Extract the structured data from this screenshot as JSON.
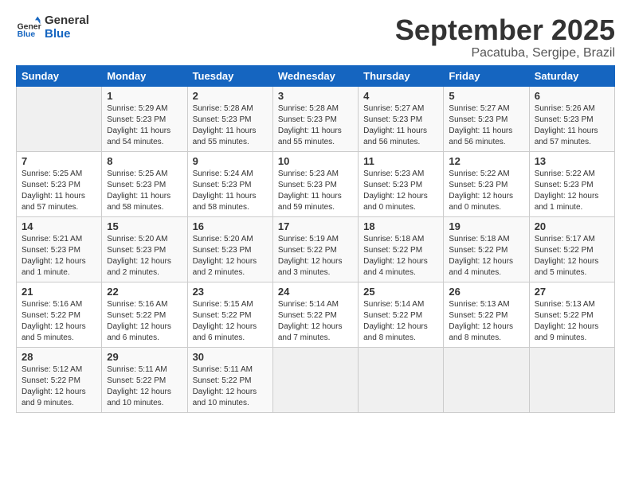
{
  "header": {
    "logo_line1": "General",
    "logo_line2": "Blue",
    "month": "September 2025",
    "location": "Pacatuba, Sergipe, Brazil"
  },
  "weekdays": [
    "Sunday",
    "Monday",
    "Tuesday",
    "Wednesday",
    "Thursday",
    "Friday",
    "Saturday"
  ],
  "weeks": [
    [
      {
        "day": "",
        "info": ""
      },
      {
        "day": "1",
        "info": "Sunrise: 5:29 AM\nSunset: 5:23 PM\nDaylight: 11 hours\nand 54 minutes."
      },
      {
        "day": "2",
        "info": "Sunrise: 5:28 AM\nSunset: 5:23 PM\nDaylight: 11 hours\nand 55 minutes."
      },
      {
        "day": "3",
        "info": "Sunrise: 5:28 AM\nSunset: 5:23 PM\nDaylight: 11 hours\nand 55 minutes."
      },
      {
        "day": "4",
        "info": "Sunrise: 5:27 AM\nSunset: 5:23 PM\nDaylight: 11 hours\nand 56 minutes."
      },
      {
        "day": "5",
        "info": "Sunrise: 5:27 AM\nSunset: 5:23 PM\nDaylight: 11 hours\nand 56 minutes."
      },
      {
        "day": "6",
        "info": "Sunrise: 5:26 AM\nSunset: 5:23 PM\nDaylight: 11 hours\nand 57 minutes."
      }
    ],
    [
      {
        "day": "7",
        "info": "Sunrise: 5:25 AM\nSunset: 5:23 PM\nDaylight: 11 hours\nand 57 minutes."
      },
      {
        "day": "8",
        "info": "Sunrise: 5:25 AM\nSunset: 5:23 PM\nDaylight: 11 hours\nand 58 minutes."
      },
      {
        "day": "9",
        "info": "Sunrise: 5:24 AM\nSunset: 5:23 PM\nDaylight: 11 hours\nand 58 minutes."
      },
      {
        "day": "10",
        "info": "Sunrise: 5:23 AM\nSunset: 5:23 PM\nDaylight: 11 hours\nand 59 minutes."
      },
      {
        "day": "11",
        "info": "Sunrise: 5:23 AM\nSunset: 5:23 PM\nDaylight: 12 hours\nand 0 minutes."
      },
      {
        "day": "12",
        "info": "Sunrise: 5:22 AM\nSunset: 5:23 PM\nDaylight: 12 hours\nand 0 minutes."
      },
      {
        "day": "13",
        "info": "Sunrise: 5:22 AM\nSunset: 5:23 PM\nDaylight: 12 hours\nand 1 minute."
      }
    ],
    [
      {
        "day": "14",
        "info": "Sunrise: 5:21 AM\nSunset: 5:23 PM\nDaylight: 12 hours\nand 1 minute."
      },
      {
        "day": "15",
        "info": "Sunrise: 5:20 AM\nSunset: 5:23 PM\nDaylight: 12 hours\nand 2 minutes."
      },
      {
        "day": "16",
        "info": "Sunrise: 5:20 AM\nSunset: 5:23 PM\nDaylight: 12 hours\nand 2 minutes."
      },
      {
        "day": "17",
        "info": "Sunrise: 5:19 AM\nSunset: 5:22 PM\nDaylight: 12 hours\nand 3 minutes."
      },
      {
        "day": "18",
        "info": "Sunrise: 5:18 AM\nSunset: 5:22 PM\nDaylight: 12 hours\nand 4 minutes."
      },
      {
        "day": "19",
        "info": "Sunrise: 5:18 AM\nSunset: 5:22 PM\nDaylight: 12 hours\nand 4 minutes."
      },
      {
        "day": "20",
        "info": "Sunrise: 5:17 AM\nSunset: 5:22 PM\nDaylight: 12 hours\nand 5 minutes."
      }
    ],
    [
      {
        "day": "21",
        "info": "Sunrise: 5:16 AM\nSunset: 5:22 PM\nDaylight: 12 hours\nand 5 minutes."
      },
      {
        "day": "22",
        "info": "Sunrise: 5:16 AM\nSunset: 5:22 PM\nDaylight: 12 hours\nand 6 minutes."
      },
      {
        "day": "23",
        "info": "Sunrise: 5:15 AM\nSunset: 5:22 PM\nDaylight: 12 hours\nand 6 minutes."
      },
      {
        "day": "24",
        "info": "Sunrise: 5:14 AM\nSunset: 5:22 PM\nDaylight: 12 hours\nand 7 minutes."
      },
      {
        "day": "25",
        "info": "Sunrise: 5:14 AM\nSunset: 5:22 PM\nDaylight: 12 hours\nand 8 minutes."
      },
      {
        "day": "26",
        "info": "Sunrise: 5:13 AM\nSunset: 5:22 PM\nDaylight: 12 hours\nand 8 minutes."
      },
      {
        "day": "27",
        "info": "Sunrise: 5:13 AM\nSunset: 5:22 PM\nDaylight: 12 hours\nand 9 minutes."
      }
    ],
    [
      {
        "day": "28",
        "info": "Sunrise: 5:12 AM\nSunset: 5:22 PM\nDaylight: 12 hours\nand 9 minutes."
      },
      {
        "day": "29",
        "info": "Sunrise: 5:11 AM\nSunset: 5:22 PM\nDaylight: 12 hours\nand 10 minutes."
      },
      {
        "day": "30",
        "info": "Sunrise: 5:11 AM\nSunset: 5:22 PM\nDaylight: 12 hours\nand 10 minutes."
      },
      {
        "day": "",
        "info": ""
      },
      {
        "day": "",
        "info": ""
      },
      {
        "day": "",
        "info": ""
      },
      {
        "day": "",
        "info": ""
      }
    ]
  ]
}
